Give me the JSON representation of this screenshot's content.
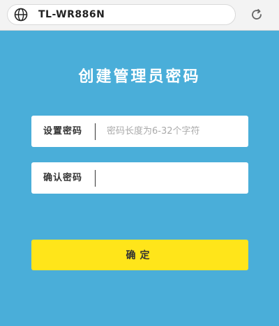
{
  "browser": {
    "url": "TL-WR886N",
    "globe_icon": "globe-icon",
    "reload_icon": "reload-icon"
  },
  "page": {
    "title": "创建管理员密码"
  },
  "form": {
    "password_label": "设置密码",
    "password_placeholder": "密码长度为6-32个字符",
    "password_value": "",
    "confirm_label": "确认密码",
    "confirm_placeholder": "",
    "confirm_value": "",
    "submit_label": "确定"
  },
  "colors": {
    "background": "#4aaed9",
    "button": "#ffe51a",
    "field": "#ffffff"
  }
}
